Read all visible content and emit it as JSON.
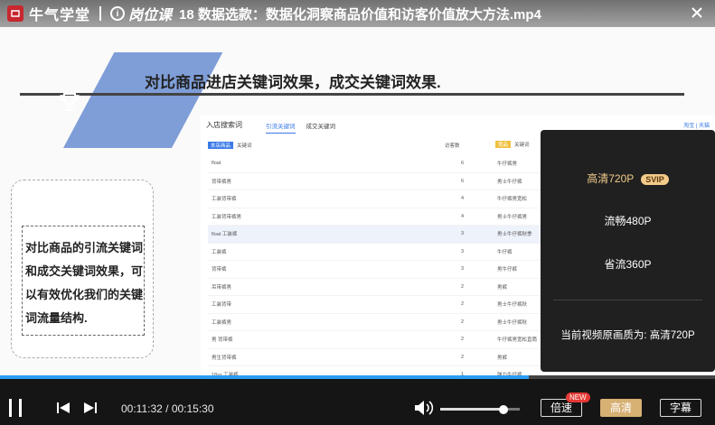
{
  "titlebar": {
    "brand": "牛气学堂",
    "brand2": "岗位课",
    "video_title": "18 数据选款：数据化洞察商品价值和访客价值放大方法.mp4"
  },
  "slide": {
    "heading": "对比商品进店关键词效果，成交关键词效果.",
    "note": "对比商品的引流关键词和成交关键词效果，可以有效优化我们的关键词流量结构."
  },
  "table": {
    "title": "入店搜索词",
    "tabs": [
      "引流关键词",
      "成交关键词"
    ],
    "right_links": "淘宝 | 天猫",
    "left_tag": "本店商品",
    "left_col": "关键词",
    "visit_col": "访客数",
    "right_tag": "竞品",
    "right_col": "关键词",
    "rows": [
      {
        "kw": "float",
        "num": "6",
        "kw2": "牛仔裤男"
      },
      {
        "kw": "背带裤男",
        "num": "6",
        "kw2": "男士牛仔裤"
      },
      {
        "kw": "工装背带裤",
        "num": "4",
        "kw2": "牛仔裤男宽松"
      },
      {
        "kw": "工装背带裤男",
        "num": "4",
        "kw2": "男士牛仔裤男"
      },
      {
        "kw": "float 工装裤",
        "num": "3",
        "kw2": "男士牛仔裤秋季"
      },
      {
        "kw": "工装裤",
        "num": "3",
        "kw2": "牛仔裤"
      },
      {
        "kw": "背带裤",
        "num": "3",
        "kw2": "男牛仔裤"
      },
      {
        "kw": "吊带裤男",
        "num": "2",
        "kw2": "男裤"
      },
      {
        "kw": "工装背带",
        "num": "2",
        "kw2": "男士牛仔裤秋"
      },
      {
        "kw": "工装裤男",
        "num": "2",
        "kw2": "男士牛仔裤秋"
      },
      {
        "kw": "男 背带裤",
        "num": "2",
        "kw2": "牛仔裤男宽松直筒"
      },
      {
        "kw": "男生背带裤",
        "num": "2",
        "kw2": "男裤"
      },
      {
        "kw": "18ss 工装裤",
        "num": "1",
        "kw2": "弹力牛仔裤"
      }
    ]
  },
  "quality": {
    "options": [
      {
        "label": "高清720P",
        "badge": "SVIP"
      },
      {
        "label": "流畅480P"
      },
      {
        "label": "省流360P"
      }
    ],
    "current": "当前视频原画质为: 高清720P"
  },
  "player": {
    "progress": 0.74,
    "volume": 0.8,
    "time": "00:11:32 / 00:15:30",
    "speed_label": "倍速",
    "new_badge": "NEW",
    "quality_label": "高清",
    "subtitle_label": "字幕"
  },
  "colors": {
    "accent_blue": "#2a9df4",
    "gold": "#d7b074",
    "slide_parallelogram": "#7f9ed8"
  }
}
